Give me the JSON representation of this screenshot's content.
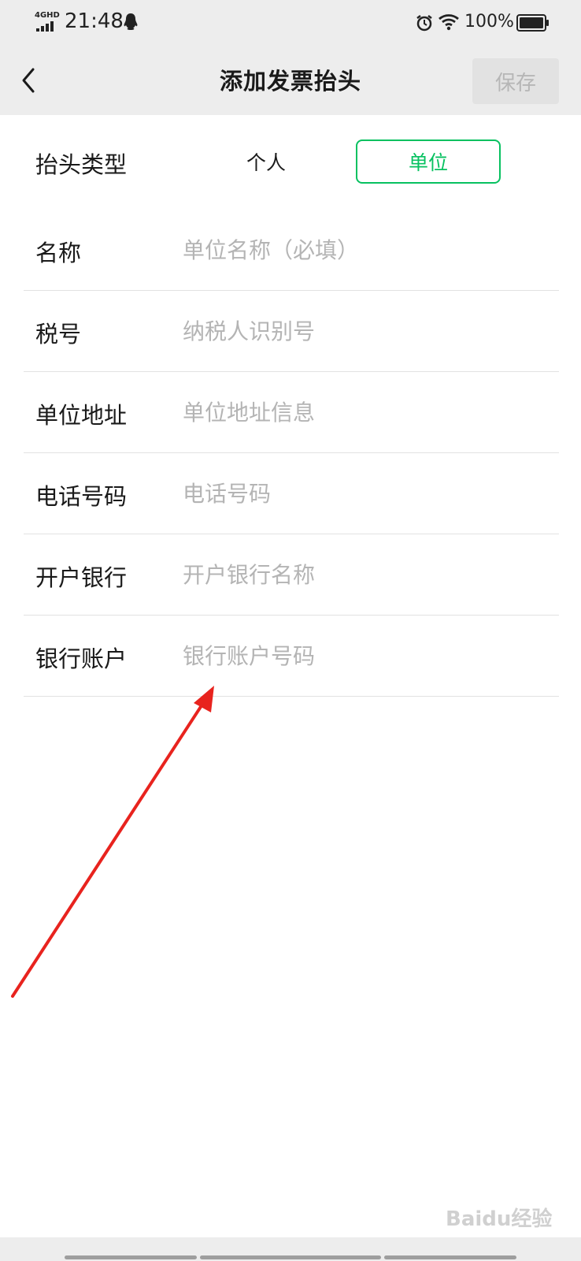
{
  "status_bar": {
    "network": "4GHD",
    "time": "21:48",
    "battery_percent": "100%"
  },
  "nav": {
    "title": "添加发票抬头",
    "save_label": "保存"
  },
  "header_type": {
    "label": "抬头类型",
    "options": [
      "个人",
      "单位"
    ],
    "selected": "单位",
    "accent_color": "#07c160"
  },
  "form": {
    "fields": [
      {
        "label": "名称",
        "placeholder": "单位名称（必填）",
        "value": ""
      },
      {
        "label": "税号",
        "placeholder": "纳税人识别号",
        "value": ""
      },
      {
        "label": "单位地址",
        "placeholder": "单位地址信息",
        "value": ""
      },
      {
        "label": "电话号码",
        "placeholder": "电话号码",
        "value": ""
      },
      {
        "label": "开户银行",
        "placeholder": "开户银行名称",
        "value": ""
      },
      {
        "label": "银行账户",
        "placeholder": "银行账户号码",
        "value": ""
      }
    ]
  },
  "annotation": {
    "arrow_color": "#e8231e"
  },
  "watermark": {
    "text": "Baidu经验"
  }
}
